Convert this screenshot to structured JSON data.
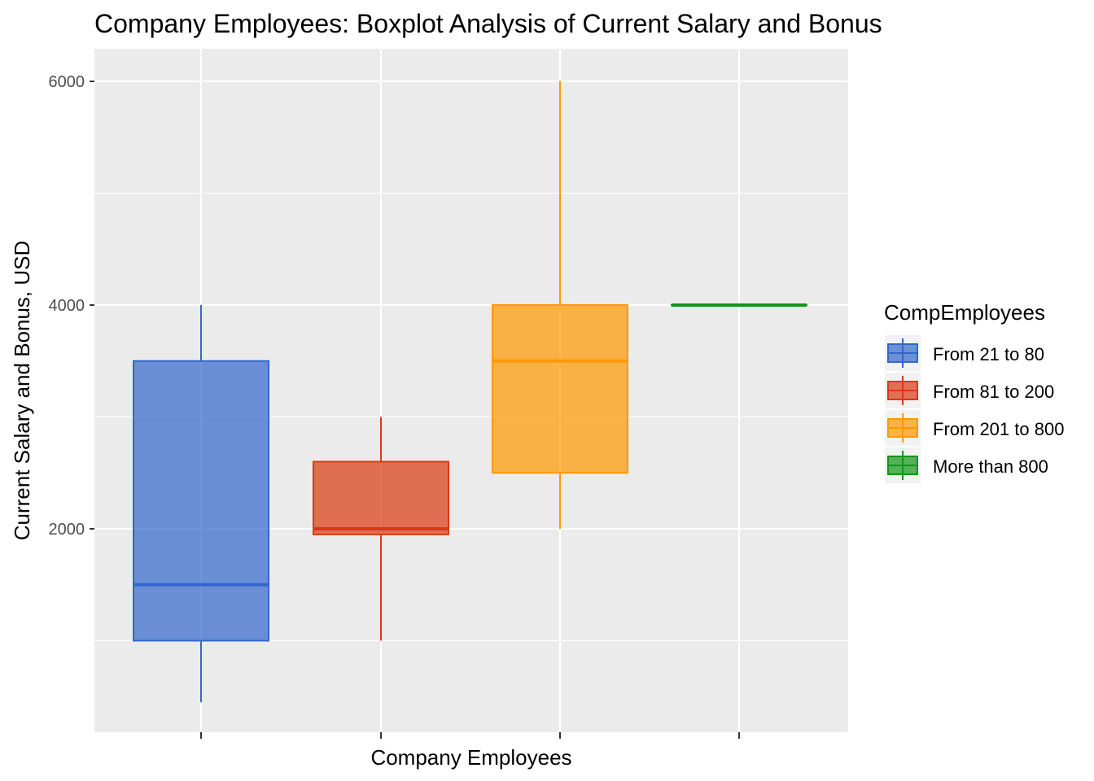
{
  "chart_data": {
    "type": "boxplot",
    "title": "Company Employees: Boxplot Analysis of Current Salary and Bonus",
    "xlabel": "Company Employees",
    "ylabel": "Current Salary and Bonus, USD",
    "ylim": [
      -200,
      6200
    ],
    "yticks": [
      2000,
      4000,
      6000
    ],
    "ytick_labels": [
      "2000",
      "4000",
      "6000"
    ],
    "minor_yticks": [
      1000,
      3000,
      5000
    ],
    "xtick_labels": [
      "",
      "",
      "",
      ""
    ],
    "grid": true,
    "legend": {
      "title": "CompEmployees",
      "position": "right"
    },
    "series": [
      {
        "name": "From 21 to 80",
        "color": "#3366CC",
        "min": 450,
        "q1": 1000,
        "median": 1500,
        "q3": 3500,
        "max": 4000
      },
      {
        "name": "From 81 to 200",
        "color": "#DC3912",
        "min": 1000,
        "q1": 1950,
        "median": 2000,
        "q3": 2600,
        "max": 3000
      },
      {
        "name": "From 201 to 800",
        "color": "#FF9900",
        "min": 2000,
        "q1": 2500,
        "median": 3500,
        "q3": 4000,
        "max": 6000
      },
      {
        "name": "More than 800",
        "color": "#109618",
        "min": 4000,
        "q1": 4000,
        "median": 4000,
        "q3": 4000,
        "max": 4000
      }
    ]
  }
}
